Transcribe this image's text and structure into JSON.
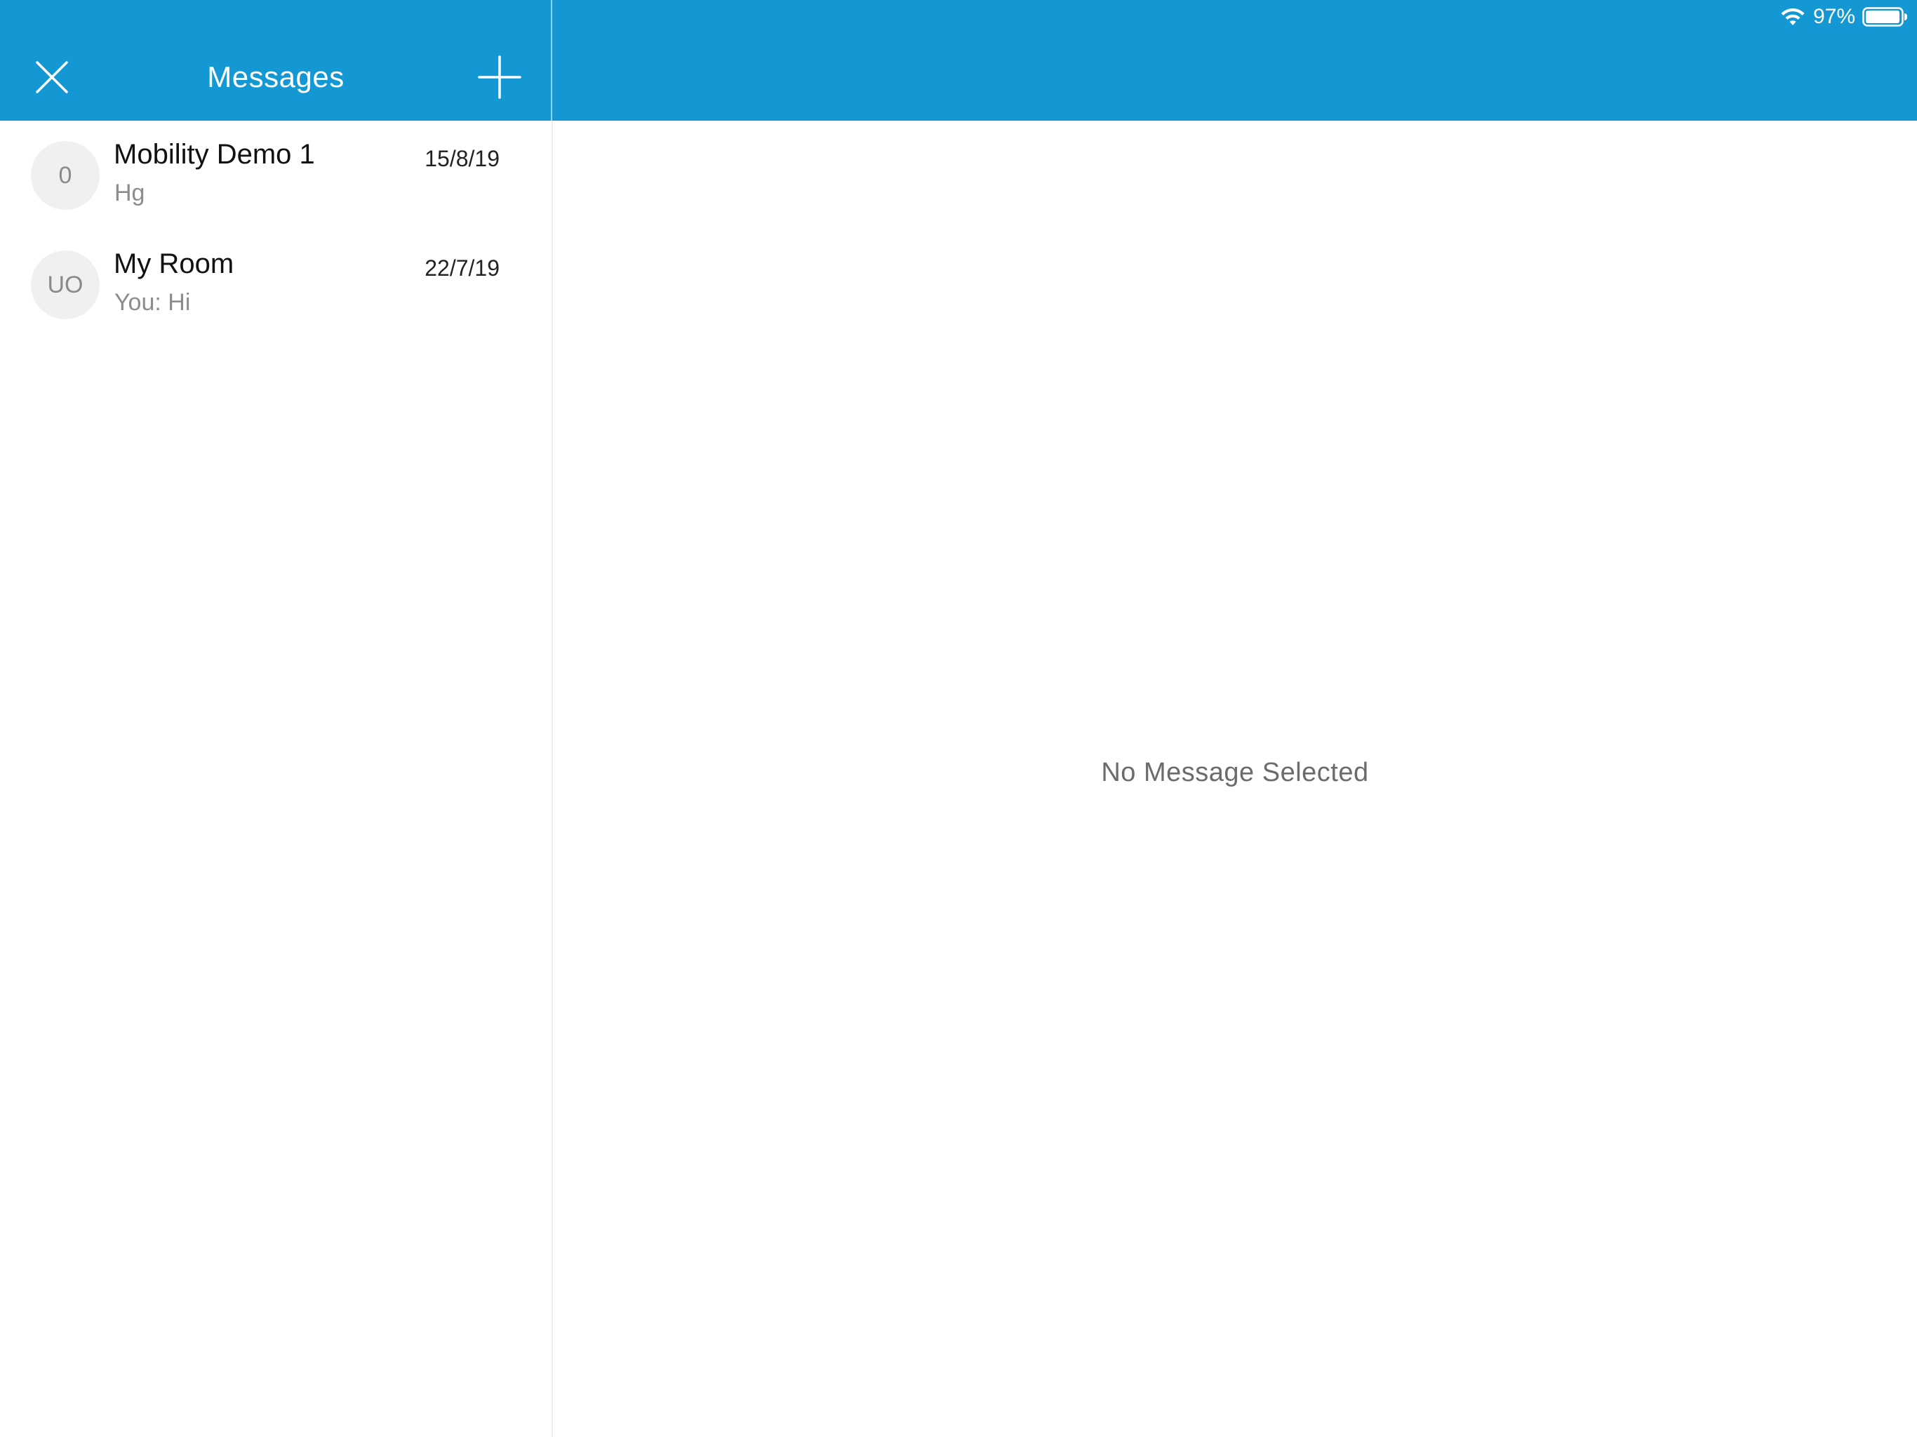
{
  "status_bar": {
    "battery_text": "97%",
    "wifi_icon": "wifi-icon",
    "battery_icon": "battery-icon"
  },
  "nav": {
    "title": "Messages",
    "close_icon": "close-icon",
    "add_icon": "plus-icon"
  },
  "conversations": [
    {
      "avatar": "0",
      "title": "Mobility Demo 1",
      "preview": "Hg",
      "date": "15/8/19"
    },
    {
      "avatar": "UO",
      "title": "My Room",
      "preview": "You: Hi",
      "date": "22/7/19"
    }
  ],
  "detail": {
    "empty_text": "No Message Selected"
  },
  "colors": {
    "accent": "#1498d3",
    "avatar_bg": "#f0f0f0",
    "secondary_text": "#8c8c8c"
  }
}
